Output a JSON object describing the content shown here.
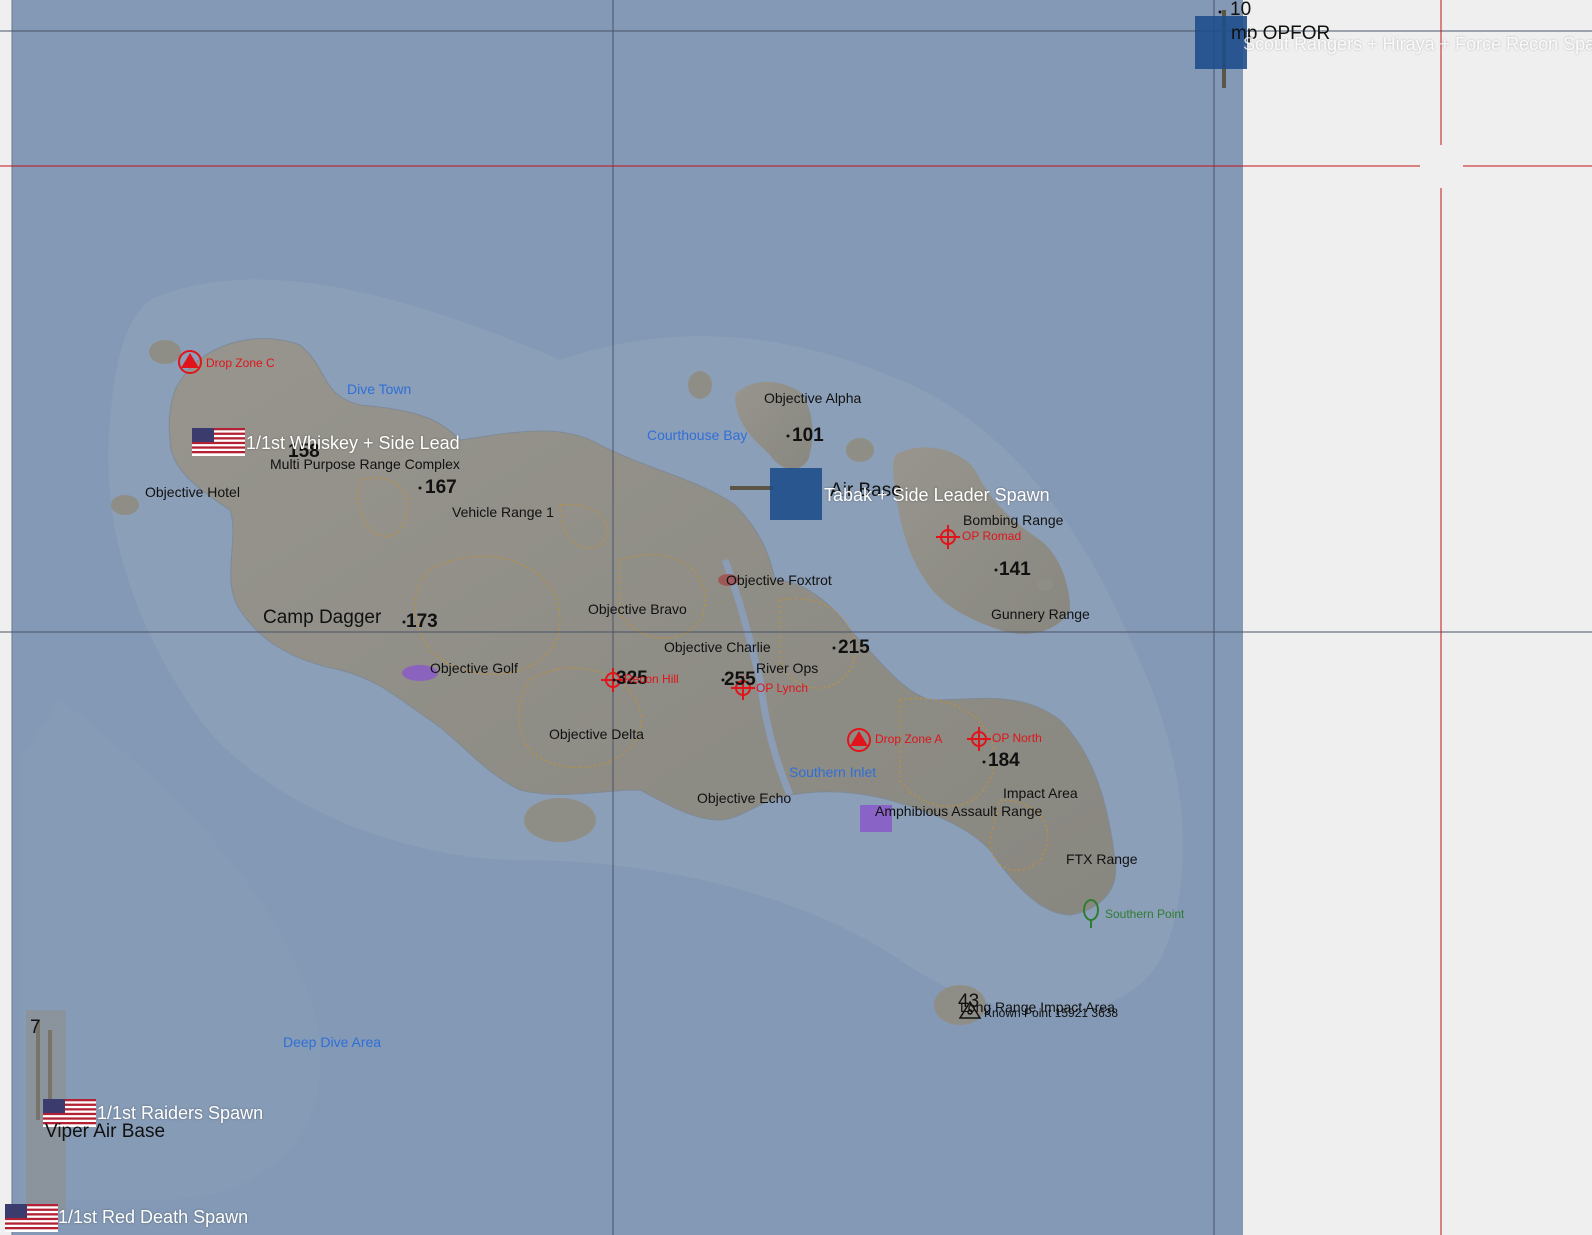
{
  "colors": {
    "sea": "#8399b5",
    "sea_shallow": "#90a2ba",
    "land": "#8f8e86",
    "offmap": "#efefef",
    "marker_red": "#e0141a",
    "location_blue": "#2f6fd8",
    "vegetation_green": "#2e7d32",
    "contour": "#c7912c",
    "side_marker": "#1f4e8c"
  },
  "icons": {
    "drop_zone": "triangle-in-circle-icon",
    "observation_post": "crosshair-icon",
    "flag": "us-flag-icon",
    "vegetation": "tree-icon",
    "known_point": "trig-point-icon",
    "side_spawn": "blue-square-icon"
  },
  "map": {
    "elevations": {
      "e10": "10",
      "e101": "101",
      "e167": "167",
      "e158": "158",
      "e173": "173",
      "e141": "141",
      "e215": "215",
      "e325": "325",
      "e255": "255",
      "e184": "184",
      "e43": "43",
      "e7": "7"
    },
    "labels": {
      "camp_opfor": "mp OPFOR",
      "scout_rangers": "Scout Rangers + Hiraya + Force Recon Spawn",
      "drop_zone_c": "Drop Zone C",
      "dive_town": "Dive Town",
      "objective_alpha": "Objective Alpha",
      "courthouse_bay": "Courthouse Bay",
      "whiskey": "1/1st Whiskey + Side Lead",
      "multi_purpose": "Multi Purpose Range Complex",
      "objective_hotel": "Objective Hotel",
      "vehicle_range": "Vehicle Range 1",
      "air_base": "Air Base",
      "tabak": "Tabak + Side Leader Spawn",
      "bombing_range": "Bombing Range",
      "op_romad": "OP Romad",
      "objective_foxtrot": "Objective Foxtrot",
      "camp_dagger": "Camp Dagger",
      "objective_bravo": "Objective Bravo",
      "gunnery_range": "Gunnery Range",
      "objective_charlie": "Objective Charlie",
      "objective_golf": "Objective Golf",
      "recon_hill": "Recon Hill",
      "river_ops": "River Ops",
      "op_lynch": "OP Lynch",
      "objective_delta": "Objective Delta",
      "drop_zone_a": "Drop Zone A",
      "op_north": "OP North",
      "southern_inlet": "Southern Inlet",
      "impact_area": "Impact Area",
      "objective_echo": "Objective Echo",
      "amphibious": "Amphibious Assault Range",
      "ftx_range": "FTX Range",
      "southern_point": "Southern Point",
      "long_range": "Long Range Impact Area",
      "known_point": "Known Point 15921 3638",
      "deep_dive": "Deep Dive Area",
      "raiders": "1/1st Raiders Spawn",
      "viper": "Viper Air Base",
      "red_death": "1/1st Red Death Spawn"
    }
  }
}
